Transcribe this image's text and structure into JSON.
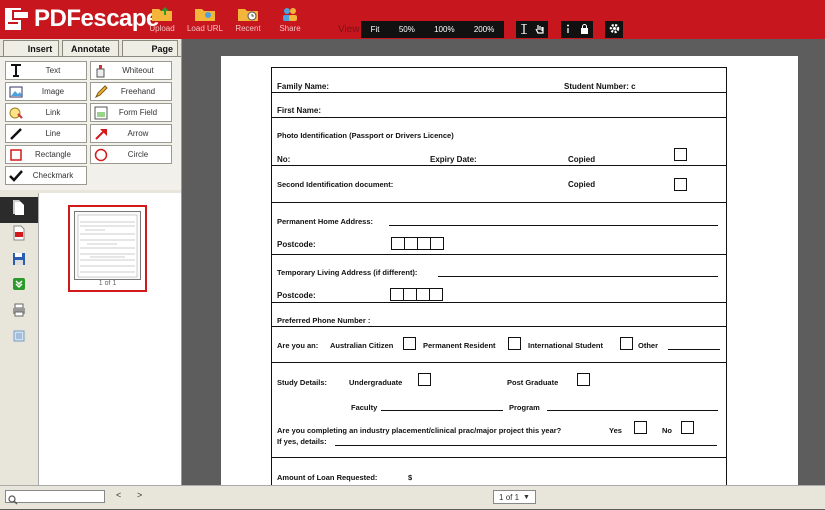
{
  "app": {
    "name": "PDFescape"
  },
  "toolbar": {
    "upload": "Upload",
    "load_url": "Load URL",
    "recent": "Recent",
    "share": "Share",
    "view_label": "View",
    "zoom": [
      "Fit",
      "50%",
      "100%",
      "200%"
    ]
  },
  "tabs": {
    "insert": "Insert",
    "annotate": "Annotate",
    "page": "Page"
  },
  "tools": {
    "text": "Text",
    "whiteout": "Whiteout",
    "image": "Image",
    "freehand": "Freehand",
    "link": "Link",
    "form_field": "Form Field",
    "line": "Line",
    "arrow": "Arrow",
    "rectangle": "Rectangle",
    "circle": "Circle",
    "checkmark": "Checkmark"
  },
  "thumbnail": {
    "label": "1 of 1"
  },
  "pager": {
    "prev": "<",
    "next": ">",
    "current": "1 of 1"
  },
  "form": {
    "family_name": "Family Name:",
    "student_number": "Student Number: c",
    "first_name": "First Name:",
    "photo_id": "Photo Identification (Passport or Drivers Licence)",
    "no": "No:",
    "expiry": "Expiry Date:",
    "copied": "Copied",
    "second_id": "Second Identification document:",
    "perm_address": "Permanent Home Address:",
    "postcode": "Postcode:",
    "temp_address": "Temporary Living Address (if different):",
    "phone": "Preferred Phone Number :",
    "are_you": "Are you an:",
    "aus_citizen": "Australian Citizen",
    "perm_resident": "Permanent Resident",
    "intl_student": "International Student",
    "other": "Other",
    "study_details": "Study Details:",
    "undergrad": "Undergraduate",
    "postgrad": "Post Graduate",
    "faculty": "Faculty",
    "program": "Program",
    "placement_q": "Are you completing an industry placement/clinical prac/major project this year?",
    "yes": "Yes",
    "no_opt": "No",
    "if_yes": "If yes, details:",
    "loan": "Amount of Loan Requested:",
    "dollar": "$"
  }
}
